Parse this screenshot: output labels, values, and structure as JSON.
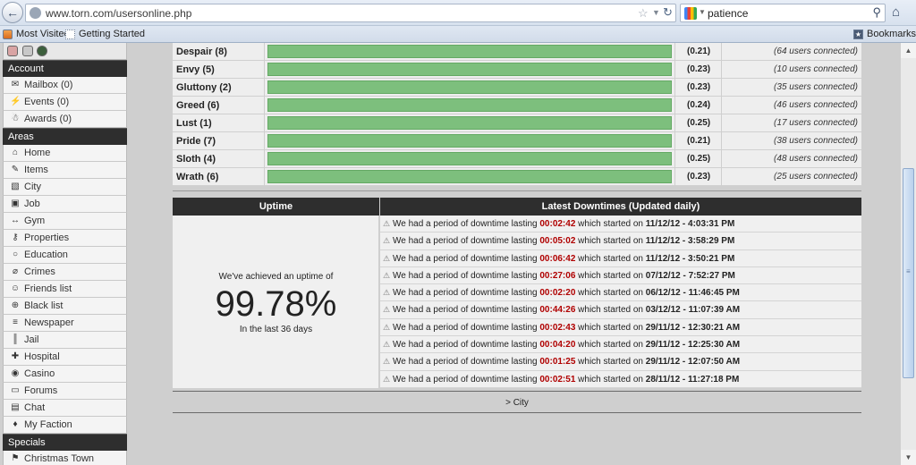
{
  "browser": {
    "url": "www.torn.com/usersonline.php",
    "search_query": "patience",
    "bookmarks": [
      "Most Visited",
      "Getting Started"
    ],
    "bookmarks_menu": "Bookmarks"
  },
  "sidebar": {
    "sections": [
      {
        "title": "Account",
        "items": [
          {
            "label": "Mailbox (0)",
            "icon": "envelope-icon"
          },
          {
            "label": "Events (0)",
            "icon": "lightning-icon"
          },
          {
            "label": "Awards (0)",
            "icon": "medal-icon"
          }
        ]
      },
      {
        "title": "Areas",
        "items": [
          {
            "label": "Home",
            "icon": "home-icon"
          },
          {
            "label": "Items",
            "icon": "pen-icon"
          },
          {
            "label": "City",
            "icon": "map-icon"
          },
          {
            "label": "Job",
            "icon": "briefcase-icon"
          },
          {
            "label": "Gym",
            "icon": "dumbbell-icon"
          },
          {
            "label": "Properties",
            "icon": "key-icon"
          },
          {
            "label": "Education",
            "icon": "lightbulb-icon"
          },
          {
            "label": "Crimes",
            "icon": "gun-icon"
          },
          {
            "label": "Friends list",
            "icon": "person-icon"
          },
          {
            "label": "Black list",
            "icon": "globe-icon"
          },
          {
            "label": "Newspaper",
            "icon": "newspaper-icon"
          },
          {
            "label": "Jail",
            "icon": "bars-icon"
          },
          {
            "label": "Hospital",
            "icon": "cross-icon"
          },
          {
            "label": "Casino",
            "icon": "chip-icon"
          },
          {
            "label": "Forums",
            "icon": "speech-bubble-icon"
          },
          {
            "label": "Chat",
            "icon": "chat-icon"
          },
          {
            "label": "My Faction",
            "icon": "people-icon"
          }
        ]
      },
      {
        "title": "Specials",
        "items": [
          {
            "label": "Christmas Town",
            "icon": "flag-icon"
          }
        ]
      }
    ]
  },
  "servers": [
    {
      "name": "Despair (8)",
      "ratio": "(0.21)",
      "users": "(64 users connected)",
      "load": 1.0
    },
    {
      "name": "Envy (5)",
      "ratio": "(0.23)",
      "users": "(10 users connected)",
      "load": 1.0
    },
    {
      "name": "Gluttony (2)",
      "ratio": "(0.23)",
      "users": "(35 users connected)",
      "load": 1.0
    },
    {
      "name": "Greed (6)",
      "ratio": "(0.24)",
      "users": "(46 users connected)",
      "load": 1.0
    },
    {
      "name": "Lust (1)",
      "ratio": "(0.25)",
      "users": "(17 users connected)",
      "load": 1.0
    },
    {
      "name": "Pride (7)",
      "ratio": "(0.21)",
      "users": "(38 users connected)",
      "load": 1.0
    },
    {
      "name": "Sloth (4)",
      "ratio": "(0.25)",
      "users": "(48 users connected)",
      "load": 1.0
    },
    {
      "name": "Wrath (6)",
      "ratio": "(0.23)",
      "users": "(25 users connected)",
      "load": 1.0
    }
  ],
  "uptime": {
    "header": "Uptime",
    "caption": "We've achieved an uptime of",
    "value": "99.78%",
    "period": "In the last 36 days"
  },
  "downtimes": {
    "header": "Latest Downtimes (Updated daily)",
    "prefix": "We had a period of downtime lasting",
    "middle": "which started on",
    "entries": [
      {
        "duration": "00:02:42",
        "started": "11/12/12 - 4:03:31 PM"
      },
      {
        "duration": "00:05:02",
        "started": "11/12/12 - 3:58:29 PM"
      },
      {
        "duration": "00:06:42",
        "started": "11/12/12 - 3:50:21 PM"
      },
      {
        "duration": "00:27:06",
        "started": "07/12/12 - 7:52:27 PM"
      },
      {
        "duration": "00:02:20",
        "started": "06/12/12 - 11:46:45 PM"
      },
      {
        "duration": "00:44:26",
        "started": "03/12/12 - 11:07:39 AM"
      },
      {
        "duration": "00:02:43",
        "started": "29/11/12 - 12:30:21 AM"
      },
      {
        "duration": "00:04:20",
        "started": "29/11/12 - 12:25:30 AM"
      },
      {
        "duration": "00:01:25",
        "started": "29/11/12 - 12:07:50 AM"
      },
      {
        "duration": "00:02:51",
        "started": "28/11/12 - 11:27:18 PM"
      }
    ]
  },
  "footer_link": "> City",
  "colors": {
    "bar_fill": "#7dbf7d",
    "duration_red": "#b00000",
    "header_dark": "#2e2e2e"
  }
}
